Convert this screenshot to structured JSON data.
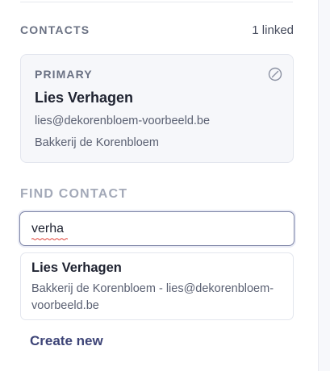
{
  "contacts": {
    "section_title": "CONTACTS",
    "linked_count": "1 linked",
    "primary": {
      "label": "PRIMARY",
      "name": "Lies Verhagen",
      "email": "lies@dekorenbloem-voorbeeld.be",
      "company": "Bakkerij de Korenbloem",
      "action_icon": "unlink-circle-icon"
    }
  },
  "find": {
    "section_title": "FIND CONTACT",
    "search_value": "verha",
    "results": [
      {
        "name": "Lies Verhagen",
        "subtitle": "Bakkerij de Korenbloem - lies@dekorenbloem-voorbeeld.be"
      }
    ],
    "create_label": "Create new"
  },
  "colors": {
    "accent": "#3d4477",
    "muted_label": "#a3a9b8",
    "card_bg": "#f6f7fa",
    "border": "#e3e6ee",
    "spell_error": "#e0443a"
  }
}
